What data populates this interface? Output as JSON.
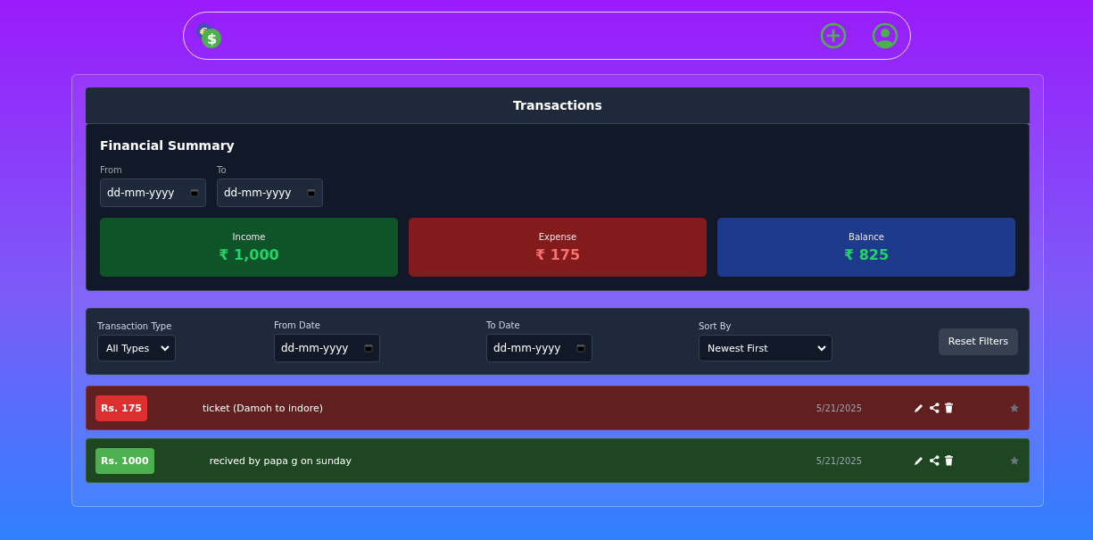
{
  "logo": {
    "symbols": [
      "€",
      "$"
    ]
  },
  "header": {
    "title": "Transactions"
  },
  "summary": {
    "title": "Financial Summary",
    "from": {
      "label": "From",
      "placeholder": "dd-mm-yyyy"
    },
    "to": {
      "label": "To",
      "placeholder": "dd-mm-yyyy"
    },
    "cards": [
      {
        "kind": "income",
        "label": "Income",
        "amount": "₹ 1,000"
      },
      {
        "kind": "expense",
        "label": "Expense",
        "amount": "₹ 175"
      },
      {
        "kind": "balance",
        "label": "Balance",
        "amount": "₹ 825"
      }
    ]
  },
  "filters": {
    "type": {
      "label": "Transaction Type",
      "value": "All Types"
    },
    "from": {
      "label": "From Date",
      "placeholder": "dd-mm-yyyy"
    },
    "to": {
      "label": "To Date",
      "placeholder": "dd-mm-yyyy"
    },
    "sort": {
      "label": "Sort By",
      "value": "Newest First"
    },
    "reset": "Reset Filters"
  },
  "transactions": [
    {
      "kind": "expense",
      "amount": "Rs. 175",
      "description": "ticket (Damoh to indore)",
      "date": "5/21/2025",
      "starred": false
    },
    {
      "kind": "income",
      "amount": "Rs. 1000",
      "description": "recived by papa g on sunday",
      "date": "5/21/2025",
      "starred": false
    }
  ]
}
